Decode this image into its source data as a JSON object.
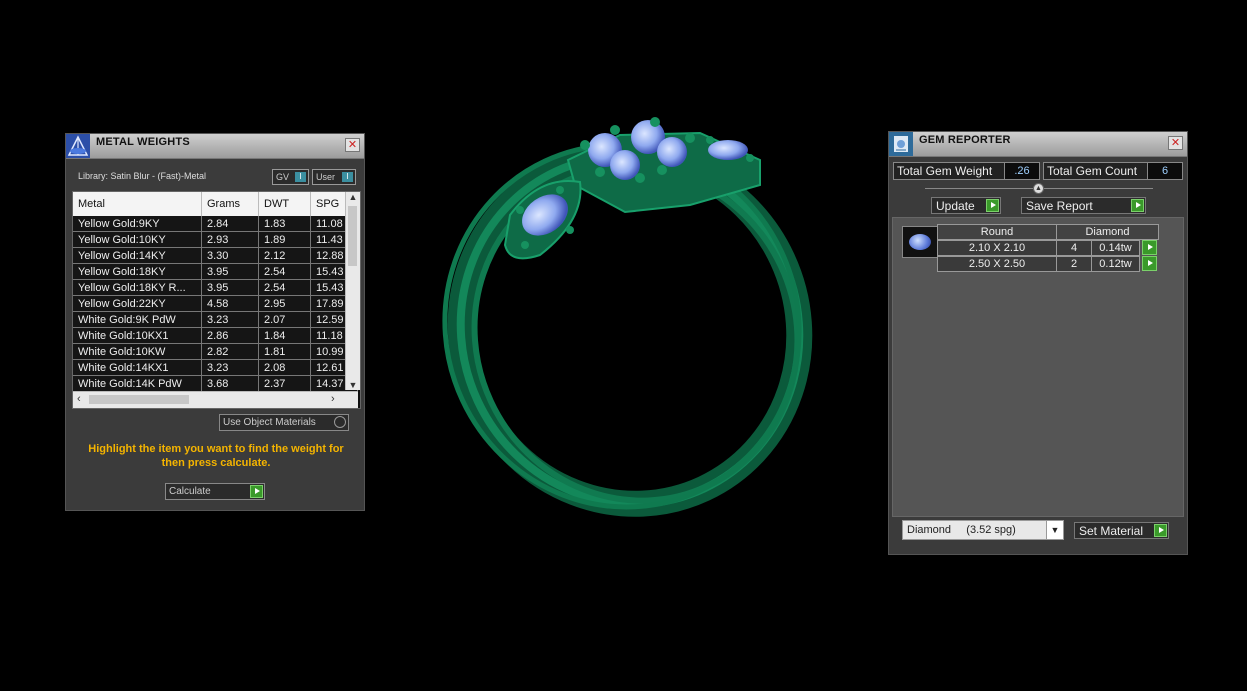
{
  "metal_weights": {
    "title": "METAL WEIGHTS",
    "library_label": "Library: Satin Blur - (Fast)-Metal",
    "toggle_gv": "GV",
    "toggle_user": "User",
    "columns": [
      "Metal",
      "Grams",
      "DWT",
      "SPG"
    ],
    "rows": [
      [
        "Yellow Gold:9KY",
        "2.84",
        "1.83",
        "11.08"
      ],
      [
        "Yellow Gold:10KY",
        "2.93",
        "1.89",
        "11.43"
      ],
      [
        "Yellow Gold:14KY",
        "3.30",
        "2.12",
        "12.88"
      ],
      [
        "Yellow Gold:18KY",
        "3.95",
        "2.54",
        "15.43"
      ],
      [
        "Yellow Gold:18KY R...",
        "3.95",
        "2.54",
        "15.43"
      ],
      [
        "Yellow Gold:22KY",
        "4.58",
        "2.95",
        "17.89"
      ],
      [
        "White Gold:9K PdW",
        "3.23",
        "2.07",
        "12.59"
      ],
      [
        "White Gold:10KX1",
        "2.86",
        "1.84",
        "11.18"
      ],
      [
        "White Gold:10KW",
        "2.82",
        "1.81",
        "10.99"
      ],
      [
        "White Gold:14KX1",
        "3.23",
        "2.08",
        "12.61"
      ],
      [
        "White Gold:14K PdW",
        "3.68",
        "2.37",
        "14.37"
      ]
    ],
    "use_object_materials": "Use Object Materials",
    "hint": "Highlight the item you want to find the weight for then press calculate.",
    "calculate": "Calculate"
  },
  "gem_reporter": {
    "title": "GEM REPORTER",
    "total_weight_label": "Total Gem Weight",
    "total_weight_value": ".26",
    "total_count_label": "Total Gem Count",
    "total_count_value": "6",
    "update": "Update",
    "save_report": "Save Report",
    "headers": [
      "Round",
      "Diamond"
    ],
    "gems": [
      {
        "size": "2.10 X 2.10",
        "count": "4",
        "weight": "0.14tw"
      },
      {
        "size": "2.50 X 2.50",
        "count": "2",
        "weight": "0.12tw"
      }
    ],
    "material_select": "Diamond     (3.52 spg)",
    "set_material": "Set Material"
  },
  "colors": {
    "ring_green": "#0e6b47",
    "gem_blue": "#8fa9ef",
    "accent_green": "#3a9a2a",
    "hint_yellow": "#f4b400"
  }
}
